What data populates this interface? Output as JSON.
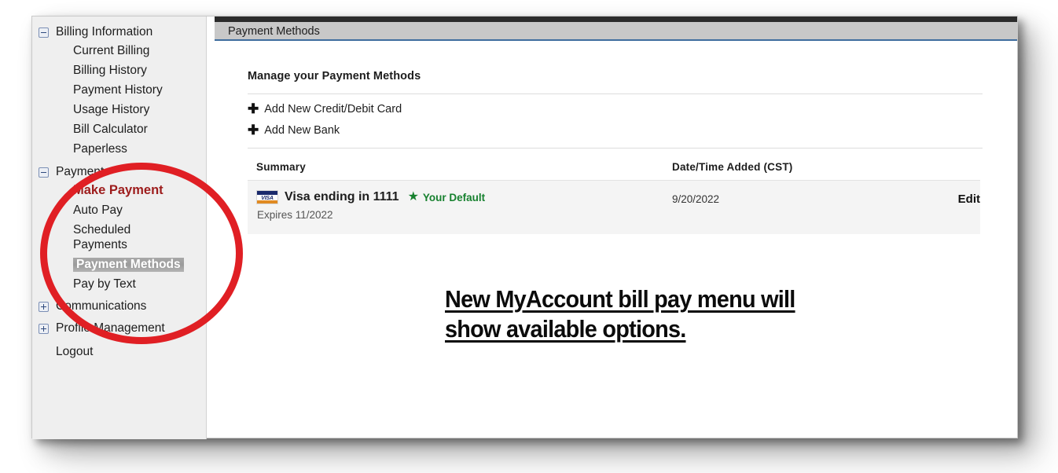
{
  "window": {
    "tab_title": "Payment Methods"
  },
  "sidebar": {
    "groups": [
      {
        "label": "Billing Information",
        "icon": "minus-box-icon",
        "expanded": true,
        "children": [
          {
            "label": "Current Billing",
            "state": "normal"
          },
          {
            "label": "Billing History",
            "state": "normal"
          },
          {
            "label": "Payment History",
            "state": "normal"
          },
          {
            "label": "Usage History",
            "state": "normal"
          },
          {
            "label": "Bill Calculator",
            "state": "normal"
          },
          {
            "label": "Paperless",
            "state": "normal"
          }
        ]
      },
      {
        "label": "Payments",
        "icon": "minus-box-icon",
        "expanded": true,
        "children": [
          {
            "label": "Make Payment",
            "state": "emphasis"
          },
          {
            "label": "Auto Pay",
            "state": "normal"
          },
          {
            "label": "Scheduled Payments",
            "state": "normal"
          },
          {
            "label": "Payment Methods",
            "state": "selected"
          },
          {
            "label": "Pay by Text",
            "state": "normal"
          }
        ]
      },
      {
        "label": "Communications",
        "icon": "plus-box-icon",
        "expanded": false,
        "children": []
      },
      {
        "label": "Profile Management",
        "icon": "plus-box-icon",
        "expanded": false,
        "children": []
      }
    ],
    "logout_label": "Logout"
  },
  "main": {
    "heading": "Manage your Payment Methods",
    "actions": [
      {
        "label": "Add New Credit/Debit Card",
        "icon": "plus-icon"
      },
      {
        "label": "Add New Bank",
        "icon": "plus-icon"
      }
    ],
    "table": {
      "headers": {
        "summary": "Summary",
        "date": "Date/Time Added (CST)",
        "action": ""
      },
      "rows": [
        {
          "brand_icon": "visa-card-icon",
          "brand_text": "VISA",
          "title": "Visa ending in 1111",
          "default_star": "★",
          "default_label": "Your Default",
          "expires": "Expires 11/2022",
          "date_added": "9/20/2022",
          "edit_label": "Edit"
        }
      ]
    }
  },
  "annotation": {
    "circle_color": "#e01f24",
    "caption_line1": "New MyAccount bill pay menu will",
    "caption_line2": "show available options."
  }
}
